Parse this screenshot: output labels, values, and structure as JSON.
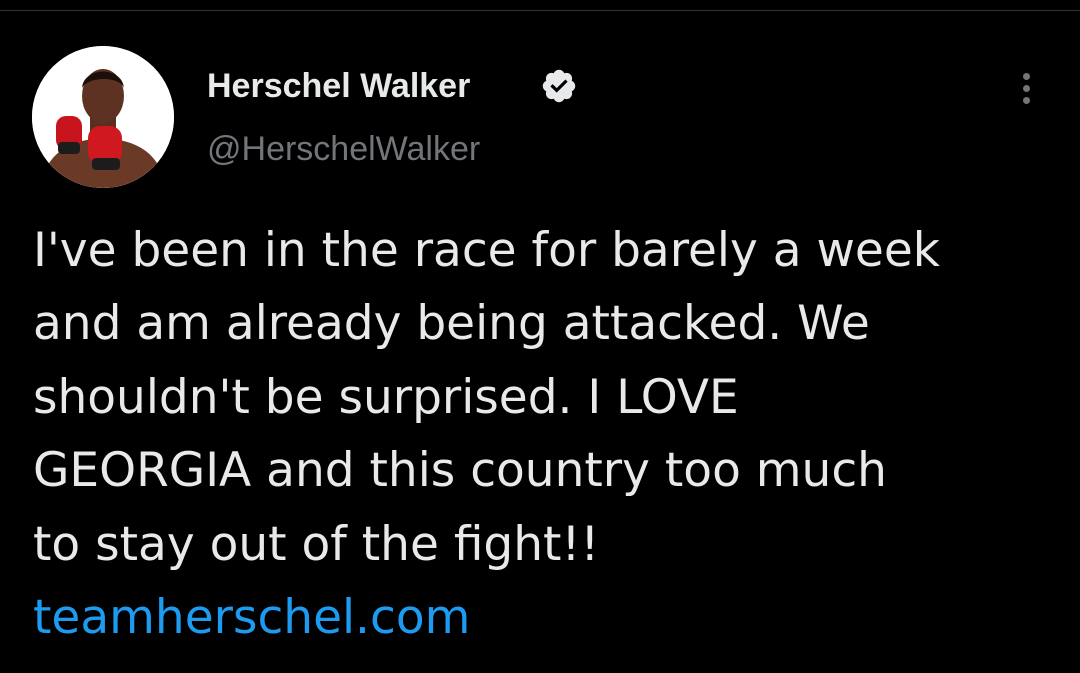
{
  "tweet": {
    "author": {
      "display_name": "Herschel Walker",
      "handle": "@HerschelWalker",
      "verified": true,
      "avatar_icon": "avatar-photo"
    },
    "text_lines": [
      "I've been in the race for barely a week",
      "and am already being attacked. We",
      "shouldn't be surprised. I LOVE",
      "GEORGIA and this country too much",
      "to stay out of the fight!!"
    ],
    "link": "teamherschel.com",
    "more_icon": "more-vertical-icon"
  },
  "colors": {
    "background": "#000000",
    "primary_text": "#e7e9ea",
    "secondary_text": "#71767b",
    "link": "#1d9bf0",
    "divider": "#2f3336"
  }
}
